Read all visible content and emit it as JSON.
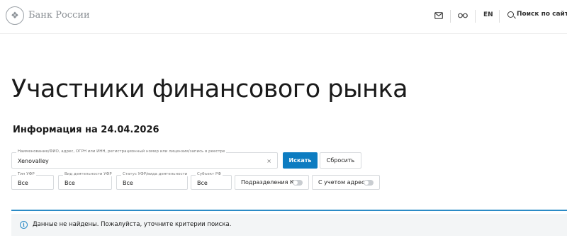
{
  "header": {
    "brand": "Банк России",
    "lang": "EN",
    "search_label": "Поиск по сайту",
    "icons": [
      "bank-emblem-icon",
      "mail-icon",
      "glasses-icon",
      "search-icon"
    ]
  },
  "page": {
    "title": "Участники финансового рынка",
    "info": "Информация на 24.04.2026"
  },
  "search": {
    "label": "Наименование/ФИО, адрес, ОГРН или ИНН, регистрационный номер или лицензия/запись в реестре",
    "value": "Xenovalley",
    "clear": "×",
    "submit_label": "Искать",
    "reset_label": "Сбросить"
  },
  "filters": [
    {
      "label": "Тип УФР",
      "value": "Все"
    },
    {
      "label": "Вид деятельности УФР",
      "value": "Все"
    },
    {
      "label": "Статус УФР/вида деятельности",
      "value": "Все"
    },
    {
      "label": "Субъект РФ",
      "value": "Все"
    }
  ],
  "toggles": [
    {
      "label": "Подразделения КО",
      "on": false
    },
    {
      "label": "С учетом адреса",
      "on": false
    }
  ],
  "alert": {
    "icon": "info-icon",
    "text": "Данные не найдены. Пожалуйста, уточните критерии поиска."
  },
  "colors": {
    "accent": "#0d7cc1",
    "alert_border": "#2b8bc6",
    "alert_bg": "#f3f5f6"
  }
}
